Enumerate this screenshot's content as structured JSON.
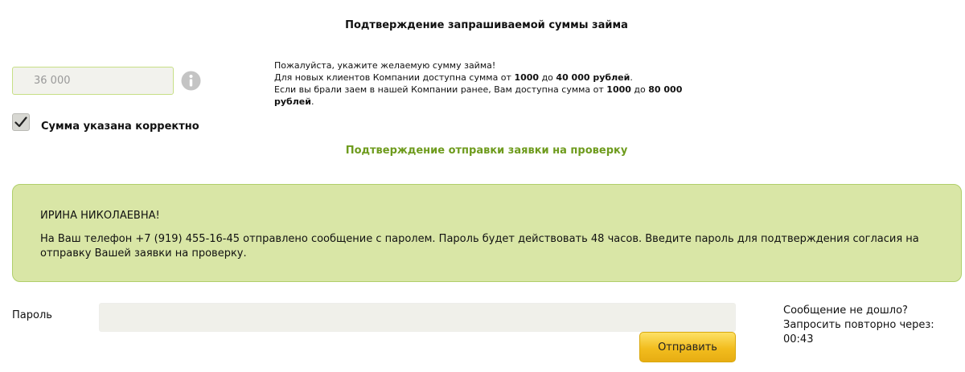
{
  "title": "Подтверждение запрашиваемой суммы займа",
  "amount": {
    "value": "36 000"
  },
  "amount_hint": {
    "line1": "Пожалуйста, укажите желаемую сумму займа!",
    "line2_prefix": "Для новых клиентов Компании доступна сумма от ",
    "line2_min": "1000",
    "line2_mid": " до ",
    "line2_max": "40 000 рублей",
    "line2_suffix": ".",
    "line3_prefix": "Если вы брали заем в нашей Компании ранее, Вам доступна сумма от ",
    "line3_min": "1000",
    "line3_mid": " до ",
    "line3_max": "80 000 рублей",
    "line3_suffix": "."
  },
  "confirm_checkbox": {
    "checked": true,
    "label": "Сумма указана корректно"
  },
  "section_heading": "Подтверждение отправки заявки на проверку",
  "notice": {
    "name": "ИРИНА НИКОЛАЕВНА!",
    "message": "На Ваш телефон +7 (919) 455-16-45 отправлено сообщение с паролем. Пароль будет действовать 48 часов. Введите пароль для подтверждения согласия на отправку Вашей заявки на проверку."
  },
  "password": {
    "label": "Пароль",
    "value": ""
  },
  "resend": {
    "line1": "Сообщение не дошло?",
    "line2_prefix": "Запросить повторно через: ",
    "timer": "00:43"
  },
  "submit_label": "Отправить",
  "icons": {
    "info": "info-icon",
    "check": "checkmark-icon"
  },
  "colors": {
    "accent_green": "#6e9b1d",
    "notice_background": "#d9e6a6",
    "notice_border": "#b0cf6a",
    "input_border_active": "#c7df86",
    "button_gold": "#f2bd1e"
  }
}
